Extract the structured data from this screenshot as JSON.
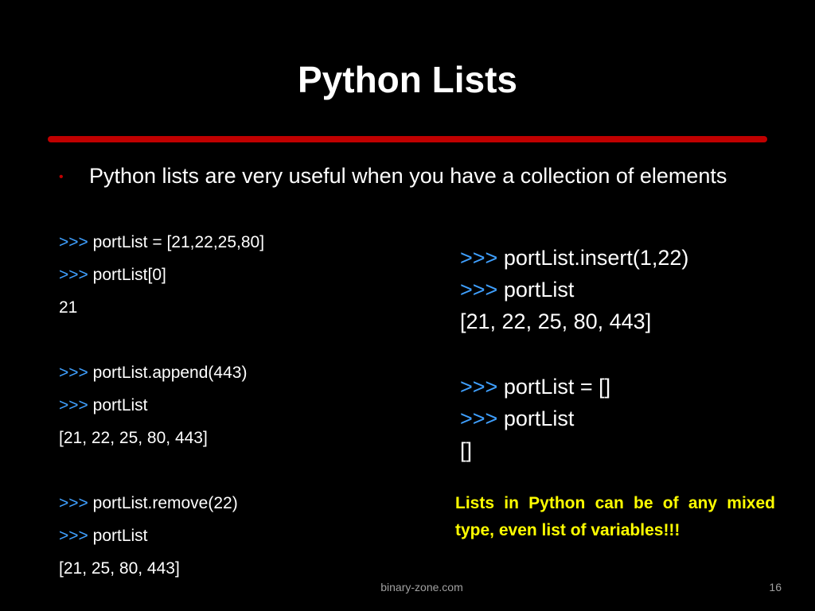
{
  "slide": {
    "title": "Python Lists",
    "bullet": "Python lists are very useful when you have a collection of elements",
    "prompt": ">>>",
    "left_code": [
      {
        "prompt": ">>>",
        "text": "portList = [21,22,25,80]"
      },
      {
        "prompt": ">>>",
        "text": "portList[0]"
      },
      {
        "prompt": "",
        "text": "21"
      },
      {
        "prompt": ">>>",
        "text": "portList.append(443)"
      },
      {
        "prompt": ">>>",
        "text": "portList"
      },
      {
        "prompt": "",
        "text": "[21, 22, 25, 80, 443]"
      },
      {
        "prompt": ">>>",
        "text": "portList.remove(22)"
      },
      {
        "prompt": ">>>",
        "text": "portList"
      },
      {
        "prompt": "",
        "text": "[21, 25, 80, 443]"
      }
    ],
    "right_code": [
      {
        "prompt": ">>>",
        "text": "portList.insert(1,22)"
      },
      {
        "prompt": ">>>",
        "text": "portList"
      },
      {
        "prompt": "",
        "text": "[21, 22, 25, 80, 443]"
      },
      {
        "prompt": ">>>",
        "text": "portList = []"
      },
      {
        "prompt": ">>>",
        "text": "portList"
      },
      {
        "prompt": "",
        "text": "[]"
      }
    ],
    "note": "Lists in Python can be of any mixed type, even list of variables!!!",
    "footer_url": "binary-zone.com",
    "page_number": "16"
  },
  "colors": {
    "background": "#000000",
    "divider": "#c00000",
    "prompt": "#3fa0ff",
    "note": "#ffff00",
    "footer": "#a0a0a0"
  },
  "icons": {
    "bullet": "bullet-dot-icon"
  }
}
